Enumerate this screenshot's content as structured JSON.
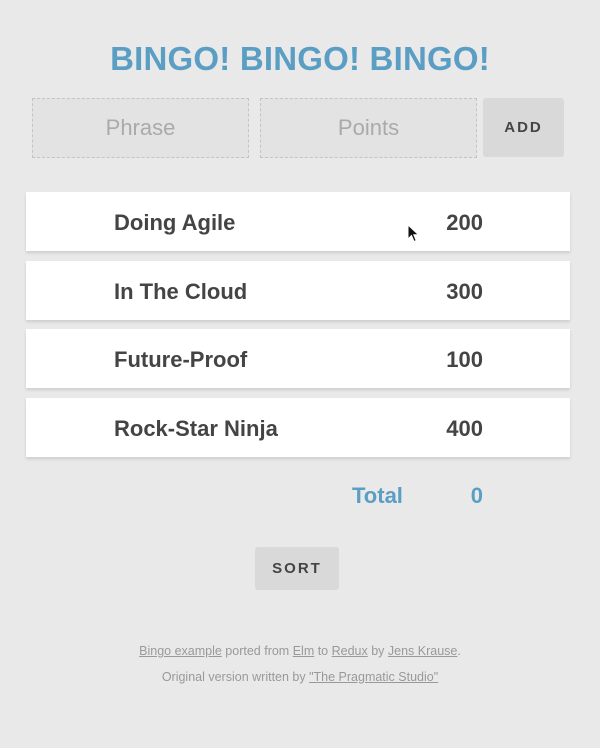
{
  "title": "BINGO! BINGO! BINGO!",
  "form": {
    "phrase_placeholder": "Phrase",
    "points_placeholder": "Points",
    "add_label": "ADD"
  },
  "entries": [
    {
      "phrase": "Doing Agile",
      "points": "200"
    },
    {
      "phrase": "In The Cloud",
      "points": "300"
    },
    {
      "phrase": "Future-Proof",
      "points": "100"
    },
    {
      "phrase": "Rock-Star Ninja",
      "points": "400"
    }
  ],
  "total": {
    "label": "Total",
    "value": "0"
  },
  "sort_label": "SORT",
  "footer": {
    "line1": {
      "link_bingo": "Bingo example",
      "text_ported": " ported from ",
      "link_elm": "Elm",
      "text_to": " to ",
      "link_redux": "Redux",
      "text_by": " by ",
      "link_author": "Jens Krause",
      "text_end": "."
    },
    "line2": {
      "text": "Original version written by ",
      "link_studio": "\"The Pragmatic Studio\""
    }
  },
  "colors": {
    "accent": "#5b9ec4",
    "background": "#e9e9e9",
    "button": "#d9d9d9"
  }
}
